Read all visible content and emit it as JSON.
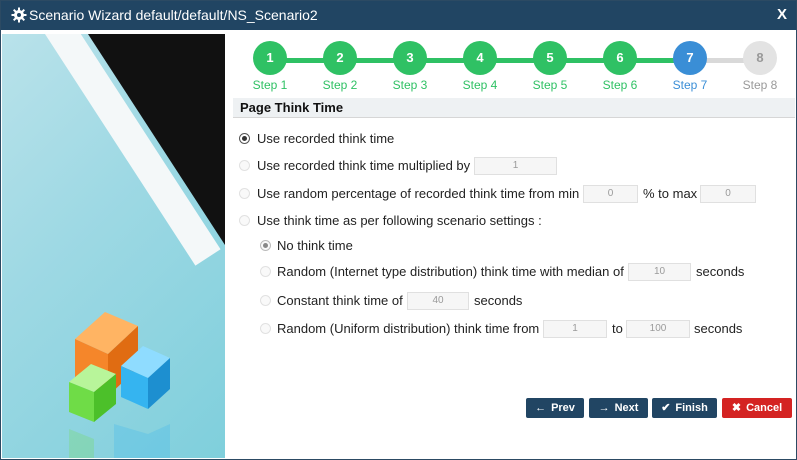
{
  "window": {
    "title": "Scenario Wizard default/default/NS_Scenario2",
    "close_label": "X"
  },
  "steps": [
    {
      "number": "1",
      "label": "Step 1",
      "state": "done"
    },
    {
      "number": "2",
      "label": "Step 2",
      "state": "done"
    },
    {
      "number": "3",
      "label": "Step 3",
      "state": "done"
    },
    {
      "number": "4",
      "label": "Step 4",
      "state": "done"
    },
    {
      "number": "5",
      "label": "Step 5",
      "state": "done"
    },
    {
      "number": "6",
      "label": "Step 6",
      "state": "done"
    },
    {
      "number": "7",
      "label": "Step 7",
      "state": "active"
    },
    {
      "number": "8",
      "label": "Step 8",
      "state": "pending"
    }
  ],
  "section": {
    "title": "Page Think Time"
  },
  "options": {
    "recorded": {
      "label": "Use recorded think time",
      "selected": true
    },
    "multiplied": {
      "label": "Use recorded think time multiplied by",
      "value": "1",
      "selected": false
    },
    "random_pct": {
      "label": "Use random percentage of recorded think time from min",
      "min_value": "0",
      "mid_label": "% to max",
      "max_value": "0",
      "selected": false
    },
    "scenario": {
      "label": "Use think time as per following scenario settings :",
      "selected": false
    }
  },
  "sub_options": {
    "none": {
      "label": "No think time",
      "selected": true
    },
    "internet": {
      "label": "Random (Internet type distribution) think time with median of",
      "value": "10",
      "unit": "seconds",
      "selected": false
    },
    "constant": {
      "label": "Constant think time of",
      "value": "40",
      "unit": "seconds",
      "selected": false
    },
    "uniform": {
      "label": "Random (Uniform distribution) think time from",
      "from_value": "1",
      "to_label": "to",
      "to_value": "100",
      "unit": "seconds",
      "selected": false
    }
  },
  "buttons": {
    "prev": "Prev",
    "next": "Next",
    "finish": "Finish",
    "cancel": "Cancel"
  },
  "colors": {
    "title_bar": "#214563",
    "step_done": "#2fc164",
    "step_active": "#3a8ed6",
    "cancel": "#d42322"
  }
}
